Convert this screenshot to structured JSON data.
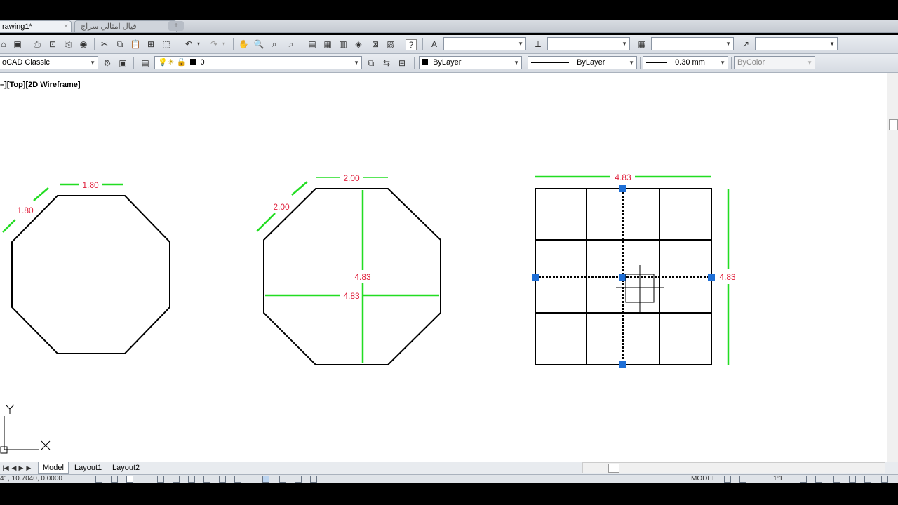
{
  "tabs": {
    "active": "rawing1*",
    "inactive": "فيال امثالي سراج",
    "close": "×"
  },
  "toolbar_standard": {
    "text_style_value": "",
    "dim_style_value": "",
    "table_style_value": "",
    "multileader_style_value": ""
  },
  "toolbar_layers": {
    "workspace": "oCAD Classic",
    "layer_name": "0",
    "color": "ByLayer",
    "linetype": "ByLayer",
    "lineweight": "0.30 mm",
    "plotstyle": "ByColor"
  },
  "viewport": {
    "label": "–][Top][2D Wireframe]"
  },
  "drawing": {
    "octagon1": {
      "top_dim": "1.80",
      "side_dim": "1.80"
    },
    "octagon2": {
      "top_dim": "2.00",
      "side_dim": "2.00",
      "vertical_dim": "4.83",
      "horizontal_dim": "4.83"
    },
    "square": {
      "top_dim": "4.83",
      "right_dim": "4.83"
    },
    "ucs": {
      "x": "X",
      "y": "Y"
    },
    "colors": {
      "dimension_line": "#22dd22",
      "dimension_text": "#e0203c",
      "grip": "#1f6fd6",
      "geometry": "#000000"
    }
  },
  "layout_tabs": [
    "Model",
    "Layout1",
    "Layout2"
  ],
  "status": {
    "coords": "41, 10.7040, 0.0000",
    "model": "MODEL",
    "scale": "1:1"
  }
}
